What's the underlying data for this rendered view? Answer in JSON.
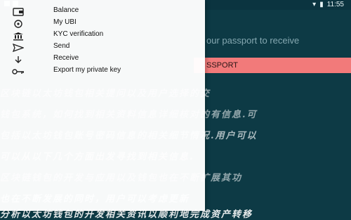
{
  "status_bar": {
    "time": "11:55"
  },
  "background": {
    "passport_prompt": "our passport to receive",
    "passport_button": "SSPORT",
    "text_lines": [
      "区块链以太坊钱包相关提问以及用户选择的交",
      "钱包系统，如何找到相关资料信息详细核对的有信息.可",
      "包括以太坊钱包账号密码信息的相关细节情况.用户可以",
      "可以从以下几个方面出发寻找到相关信息.",
      "区块链钱包的开发与应用以及钱包也在不断扩展其功",
      "也在不断发展的同时，用户可以考虑更新",
      "分析以太坊钱包的开发相关资讯以顺利地完成资产转移"
    ]
  },
  "menu": {
    "items": [
      {
        "label": "Balance",
        "icon": "balance-icon"
      },
      {
        "label": "My UBI",
        "icon": "ubi-icon"
      },
      {
        "label": "KYC verification",
        "icon": "bank-icon"
      },
      {
        "label": "Send",
        "icon": "send-icon"
      },
      {
        "label": "Receive",
        "icon": "receive-icon"
      },
      {
        "label": "Export my private key",
        "icon": "key-icon"
      }
    ]
  }
}
